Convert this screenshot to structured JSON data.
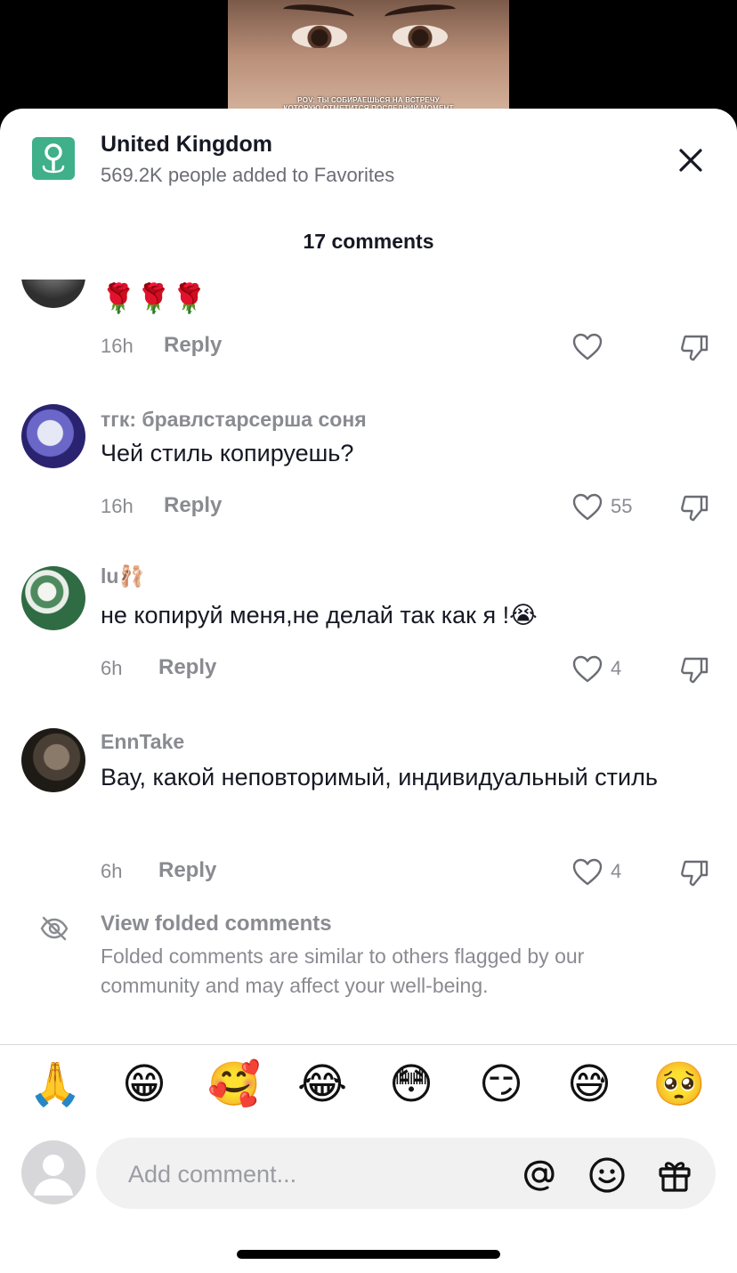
{
  "video": {
    "caption_line1": "POV: ТЫ СОБИРАЕШЬСЯ НА ВСТРЕЧУ",
    "caption_line2": "КОТОРУЮ ОТМЕТИТСЯ ПОСЛЕДНИЙ МОМЕНТ"
  },
  "header": {
    "location_title": "United Kingdom",
    "location_subtitle": "569.2K people added to Favorites",
    "comments_count": "17 comments",
    "close_icon": "close-icon"
  },
  "comments": [
    {
      "username": "",
      "text": "🌹🌹🌹",
      "time": "16h",
      "reply": "Reply",
      "likes": ""
    },
    {
      "username": "тгк: бравлстарсерша соня",
      "text": "Чей стиль копируешь?",
      "time": "16h",
      "reply": "Reply",
      "likes": "55"
    },
    {
      "username": "lu🩰",
      "text": "не копируй меня,не делай так как я !😭",
      "time": "6h",
      "reply": "Reply",
      "likes": "4"
    },
    {
      "username": "EnnTake",
      "text": "Вау, какой неповторимый, индивидуальный стиль",
      "time": "6h",
      "reply": "Reply",
      "likes": "4"
    }
  ],
  "folded": {
    "title": "View folded comments",
    "description": "Folded comments are similar to others flagged by our community and may affect your well-being."
  },
  "quick_emojis": [
    "🙏",
    "😁",
    "🥰",
    "😂",
    "😳",
    "😏",
    "😅",
    "🥺"
  ],
  "composer": {
    "placeholder": "Add comment...",
    "icons": [
      "at-icon",
      "emoji-icon",
      "gift-icon"
    ]
  }
}
